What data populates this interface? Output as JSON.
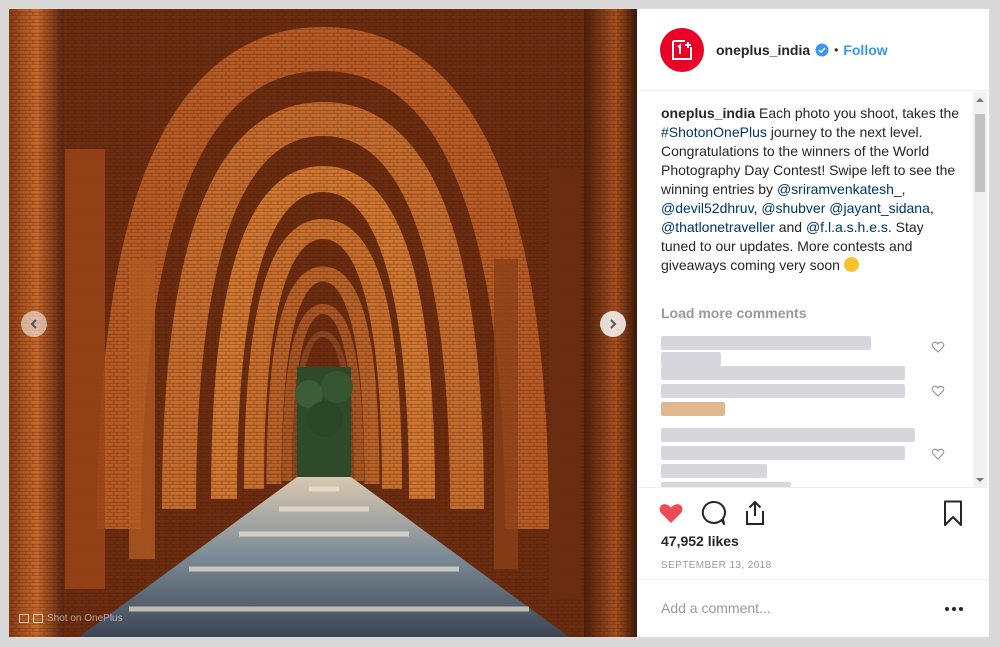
{
  "post": {
    "username": "oneplus_india",
    "follow_label": "Follow",
    "separator": "•",
    "brand_color": "#eb0028",
    "link_color": "#3897f0",
    "watermark": "Shot on OnePlus"
  },
  "caption": {
    "author": "oneplus_india",
    "text_1": " Each photo you shoot, takes the ",
    "hashtag": "#ShotonOnePlus",
    "text_2": " journey to the next level. Congratulations to the winners of the World Photography Day Contest! Swipe left to see the winning entries by ",
    "mention_1": "@sriramvenkatesh_",
    "sep_1": ", ",
    "mention_2": "@devil52dhruv",
    "sep_2": ", ",
    "mention_3": "@shubver",
    "sep_3": " ",
    "mention_4": "@jayant_sidana",
    "sep_4": ", ",
    "mention_5": "@thatlonetraveller",
    "sep_5": " and ",
    "mention_6": "@f.l.a.s.h.e.s.",
    "text_3": " Stay tuned to our updates. More contests and giveaways coming very soon "
  },
  "comments": {
    "load_more_label": "Load more comments"
  },
  "stats": {
    "likes": "47,952 likes",
    "date": "SEPTEMBER 13, 2018",
    "liked": true,
    "like_color": "#ed4956"
  },
  "composer": {
    "placeholder": "Add a comment...",
    "more_label": "•••"
  }
}
